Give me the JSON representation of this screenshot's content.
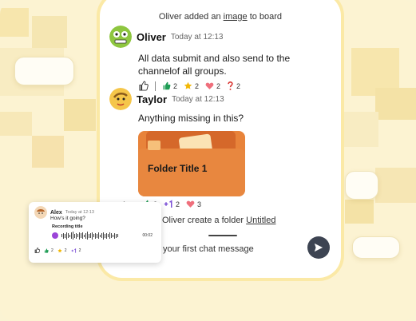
{
  "system": {
    "line1_prefix": "Oliver added an",
    "line1_link": "image",
    "line1_suffix": "to board",
    "line2_prefix": "Oliver create a folder",
    "line2_link": "Untitled"
  },
  "messages": [
    {
      "user": "Oliver",
      "time": "Today at 12:13",
      "text": "All data submit and also send to the channelof all groups.",
      "reactions": [
        {
          "icon": "thumbs-up-icon",
          "count": "2"
        },
        {
          "icon": "star-icon",
          "count": "2"
        },
        {
          "icon": "heart-icon",
          "count": "2"
        },
        {
          "icon": "question-icon",
          "count": "2"
        }
      ]
    },
    {
      "user": "Taylor",
      "time": "Today at 12:13",
      "text": "Anything missing in this?",
      "folder_title": "Folder Title 1",
      "reactions": [
        {
          "icon": "thumbs-up-icon",
          "count": "2"
        },
        {
          "icon": "plus-one-icon",
          "count": "2"
        },
        {
          "icon": "heart-icon",
          "count": "3"
        }
      ],
      "partial_reaction_count": "1"
    }
  ],
  "input": {
    "placeholder": "your first chat message"
  },
  "mini_card": {
    "user": "Alex",
    "time": "Today at 12:13",
    "text": "How's it going?",
    "recording_title": "Recording title",
    "duration": "00:02",
    "reactions": [
      "2",
      "2",
      "2"
    ]
  },
  "colors": {
    "background": "#fcf3d2",
    "phone_frame": "#fbe9a6",
    "send_button": "#3d4452",
    "folder_orange": "#e8833a",
    "thumbs_green": "#1f9d55",
    "star_yellow": "#f2b705",
    "heart_pink": "#ef6f7c",
    "question_red": "#d9332f",
    "plus_purple": "#7b4fd6",
    "play_purple": "#9b45d8"
  }
}
